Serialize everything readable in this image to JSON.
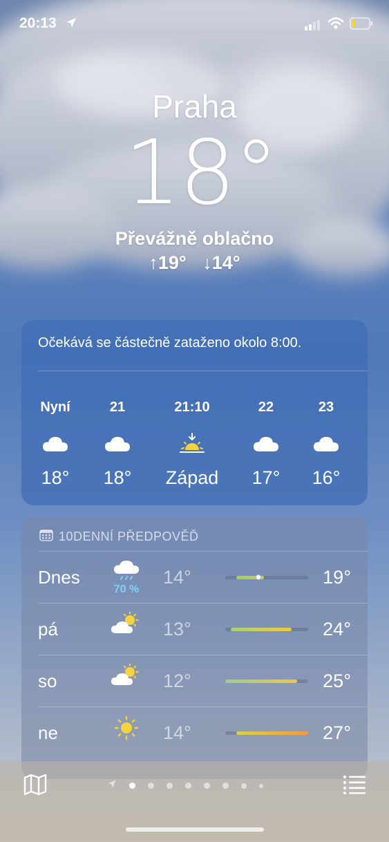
{
  "status_bar": {
    "time": "20:13"
  },
  "location": {
    "city": "Praha",
    "temperature": "18°",
    "condition": "Převážně oblačno",
    "high": "↑19°",
    "low": "↓14°"
  },
  "hourly": {
    "summary": "Očekává se částečně zataženo okolo 8:00.",
    "items": [
      {
        "time": "Nyní",
        "icon": "cloud-icon",
        "value": "18°"
      },
      {
        "time": "21",
        "icon": "cloud-icon",
        "value": "18°"
      },
      {
        "time": "21:10",
        "icon": "sunset-icon",
        "value": "Západ"
      },
      {
        "time": "22",
        "icon": "cloud-icon",
        "value": "17°"
      },
      {
        "time": "23",
        "icon": "cloud-icon",
        "value": "16°"
      }
    ]
  },
  "daily": {
    "header": "10DENNÍ PŘEDPOVĚĎ",
    "range_min": 12,
    "range_max": 27,
    "rows": [
      {
        "day": "Dnes",
        "icon": "rain-cloud-icon",
        "precip": "70 %",
        "low": "14°",
        "high": "19°",
        "lo_val": 14,
        "hi_val": 19,
        "current": 18,
        "colors": [
          "#a6cf5a",
          "#c3d24a"
        ]
      },
      {
        "day": "pá",
        "icon": "partly-cloudy-icon",
        "precip": "",
        "low": "13°",
        "high": "24°",
        "lo_val": 13,
        "hi_val": 24,
        "colors": [
          "#a5d27a",
          "#f3cb3a"
        ]
      },
      {
        "day": "so",
        "icon": "partly-cloudy-icon",
        "precip": "",
        "low": "12°",
        "high": "25°",
        "lo_val": 12,
        "hi_val": 25,
        "colors": [
          "#9ccf86",
          "#f4c73e"
        ]
      },
      {
        "day": "ne",
        "icon": "sun-icon",
        "precip": "",
        "low": "14°",
        "high": "27°",
        "lo_val": 14,
        "hi_val": 27,
        "colors": [
          "#d6d24b",
          "#f59a3d"
        ]
      }
    ]
  },
  "colors": {
    "accent_precip": "#7fd0ff",
    "card_bg": "#3e6cb4"
  }
}
